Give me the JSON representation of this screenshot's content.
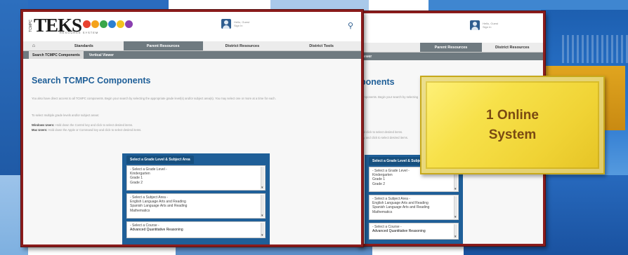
{
  "app": {
    "logo_text": "TEKS",
    "logo_side_text": "TCMPC",
    "logo_subtext": "RESOURCE SYSTEM",
    "logo_dot_colors": [
      "#e8412f",
      "#f4a21b",
      "#39a64a",
      "#2b7fd0",
      "#f2c31f",
      "#8a3fb0"
    ]
  },
  "header": {
    "user_line1": "Hello, Guest",
    "user_line2": "Sign In"
  },
  "nav": {
    "home_icon": "home-icon",
    "items": [
      "Standards",
      "Parent Resources",
      "District Resources",
      "District Tools"
    ],
    "active_index": 1
  },
  "subtabs": {
    "items": [
      "Search TCMPC Components",
      "Vertical Viewer"
    ]
  },
  "page": {
    "title": "Search TCMPC Components",
    "title_partial": "ponents",
    "intro": "You also have direct access to all TCMPC components. Begin your search by selecting the appropriate grade level(s) and/or subject area(s). You may select one or more at a time for each.",
    "hint": "To select multiple grade levels and/or subject areas:",
    "windows_label": "Windows Users:",
    "windows_text": "Hold down the Control key and click to select desired items.",
    "mac_label": "Mac Users:",
    "mac_text": "Hold down the Apple or Command key and click to select desired items.",
    "right_intro": "components. Begin your search by selecting",
    "right_windows": "and click to select desired items.",
    "right_mac": "key and click to select desired items."
  },
  "selector": {
    "header": "Select a Grade Level & Subject Area",
    "grade": {
      "options": [
        "- Select a Grade Level -",
        "Kindergarten",
        "Grade 1",
        "Grade 2"
      ]
    },
    "subject": {
      "options": [
        "- Select a Subject Area -",
        "English Language Arts and Reading",
        "Spanish Language Arts and Reading",
        "Mathematics"
      ]
    },
    "course": {
      "options": [
        "- Select a Course -",
        "Advanced Quantitative Reasoning"
      ]
    }
  },
  "callout": {
    "line1": "1 Online",
    "line2": "System"
  },
  "colors": {
    "window_border": "#8b1c1c",
    "title_blue": "#1f5f98",
    "nav_active": "#6f7a80",
    "callout_yellow": "#f7e14a",
    "callout_text": "#7a4a12",
    "backdrop_gold": "#d9981a",
    "backdrop_blue": "#2a6cbf"
  }
}
